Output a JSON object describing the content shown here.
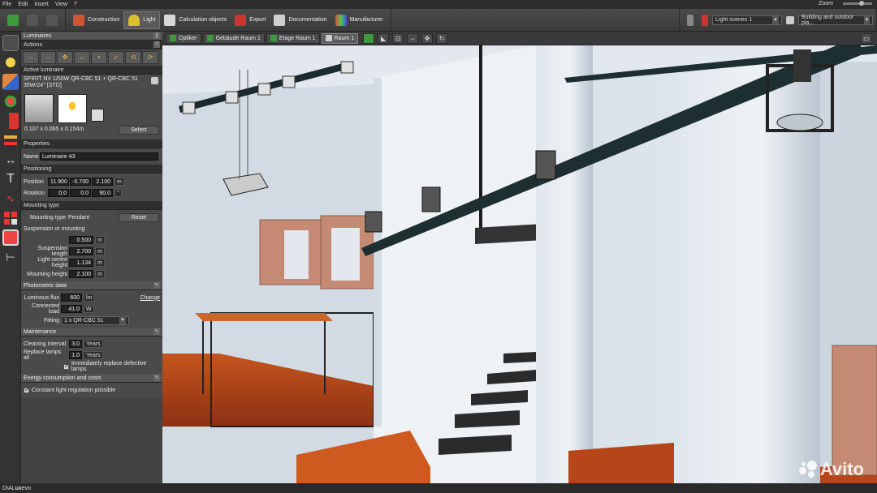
{
  "menu": {
    "items": [
      "File",
      "Edit",
      "Insert",
      "View",
      "?"
    ],
    "zoom_label": "Zoom"
  },
  "toolbar": {
    "tabs": [
      {
        "label": "Construction",
        "icon": "construction-icon"
      },
      {
        "label": "Light",
        "icon": "light-icon",
        "active": true
      },
      {
        "label": "Calculation objects",
        "icon": "calculation-icon"
      },
      {
        "label": "Export",
        "icon": "export-icon"
      },
      {
        "label": "Documentation",
        "icon": "documentation-icon"
      },
      {
        "label": "Manufacturer",
        "icon": "manufacturer-icon"
      }
    ],
    "light_scene": "Light scenes 1",
    "view_mode": "Building and outdoor pla..."
  },
  "panel": {
    "title": "Luminaires",
    "actions_title": "Actions",
    "active_luminaire_title": "Active luminaire",
    "luminaire_name": "SPIRIT NV 1/50W QR-CBC 51 + QR-CBC 51 35W/24° [STD]",
    "dimensions": "0.107 x 0.065 x 0.154m",
    "select_label": "Select",
    "properties_title": "Properties",
    "name_label": "Name",
    "name_value": "Luminaire 43",
    "positioning_title": "Positioning",
    "position_label": "Position",
    "position": [
      "11.900",
      "-0.700",
      "2.100"
    ],
    "position_unit": "m",
    "rotation_label": "Rotation",
    "rotation": [
      "0.0",
      "0.0",
      "90.0"
    ],
    "rotation_unit": "°",
    "mounting_title": "Mounting type",
    "mounting_type_label": "Mounting type",
    "mounting_type_value": "Pendant",
    "reset_label": "Reset",
    "suspension_label": "Suspension or mounting",
    "suspension_value": "0.500",
    "suspension_length_label": "Suspension length",
    "suspension_length_value": "2.700",
    "light_centre_label": "Light centre height",
    "light_centre_value": "1.134",
    "mounting_height_label": "Mounting height",
    "mounting_height_value": "2.100",
    "unit_m": "m",
    "photometric_title": "Photometric data",
    "luminous_flux_label": "Luminous flux",
    "luminous_flux_value": "600",
    "luminous_flux_unit": "lm",
    "change_label": "Change",
    "connected_load_label": "Connected load",
    "connected_load_value": "41.0",
    "connected_load_unit": "W",
    "fitting_label": "Fitting",
    "fitting_value": "1 x QR-CBC 51",
    "maintenance_title": "Maintenance",
    "cleaning_label": "Cleaning interval",
    "cleaning_value": "3.0",
    "replace_label": "Replace lamps all",
    "replace_value": "1.0",
    "years_unit": "Years",
    "immediately_label": "Immediately replace defective lamps",
    "energy_title": "Energy consumption and costs",
    "constant_label": "Constant light regulation possible"
  },
  "viewtabs": [
    {
      "label": "Optiker",
      "active": false
    },
    {
      "label": "Gebäude Raum 1",
      "active": false
    },
    {
      "label": "Etage Raum 1",
      "active": false
    },
    {
      "label": "Raum 1",
      "active": true
    }
  ],
  "status": {
    "brand_a": "DIAL",
    "brand_b": "ux",
    "brand_c": "evo"
  },
  "watermark": "Avito"
}
